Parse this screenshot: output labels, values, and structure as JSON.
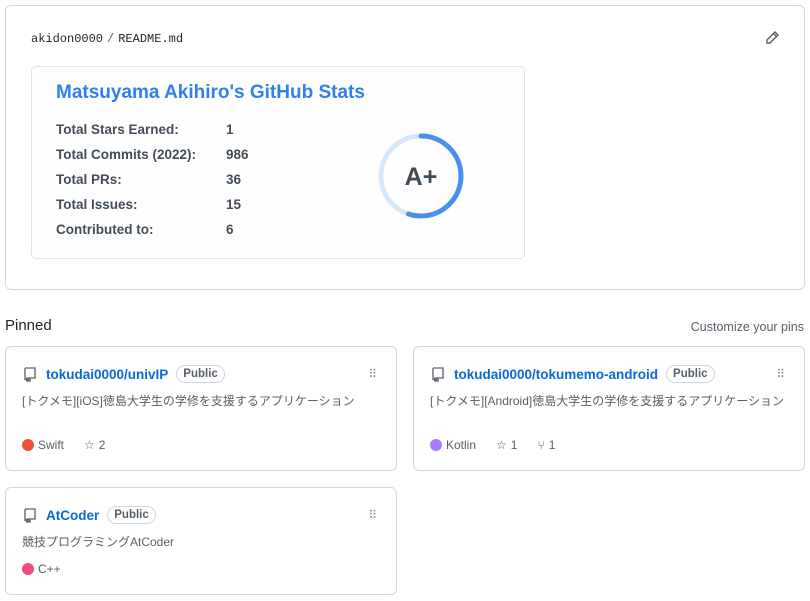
{
  "readme": {
    "owner": "akidon0000",
    "file": "README.md"
  },
  "stats": {
    "title": "Matsuyama Akihiro's GitHub Stats",
    "rows": [
      {
        "label": "Total Stars Earned:",
        "value": "1"
      },
      {
        "label": "Total Commits (2022):",
        "value": "986"
      },
      {
        "label": "Total PRs:",
        "value": "36"
      },
      {
        "label": "Total Issues:",
        "value": "15"
      },
      {
        "label": "Contributed to:",
        "value": "6"
      }
    ],
    "grade": "A+",
    "ring_progress": 0.55,
    "accent": "#2f80ed"
  },
  "pinned": {
    "title": "Pinned",
    "customize": "Customize your pins",
    "repos": [
      {
        "name": "tokudai0000/univIP",
        "badge": "Public",
        "desc": "[トクメモ][iOS]徳島大学生の学修を支援するアプリケーション",
        "lang": "Swift",
        "color": "#f05138",
        "stars": "2"
      },
      {
        "name": "tokudai0000/tokumemo-android",
        "badge": "Public",
        "desc": "[トクメモ][Android]徳島大学生の学修を支援するアプリケーション",
        "lang": "Kotlin",
        "color": "#a97bff",
        "stars": "1",
        "forks": "1"
      },
      {
        "name": "AtCoder",
        "badge": "Public",
        "desc": "競技プログラミングAtCoder",
        "lang": "C++",
        "color": "#f34b7d"
      }
    ]
  }
}
